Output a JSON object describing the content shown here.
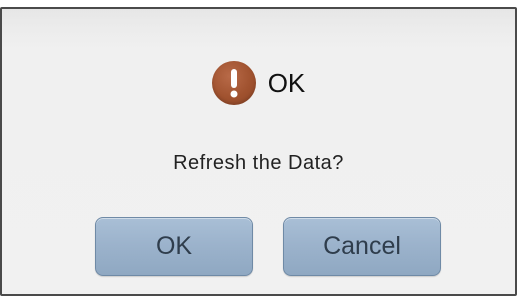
{
  "dialog": {
    "title": "OK",
    "icon": "exclamation-icon",
    "message": "Refresh the Data?",
    "buttons": {
      "ok_label": "OK",
      "cancel_label": "Cancel"
    },
    "colors": {
      "icon_background": "#a0522f",
      "button_background": "#9cb3cc",
      "button_text": "#2f3d4c"
    }
  }
}
